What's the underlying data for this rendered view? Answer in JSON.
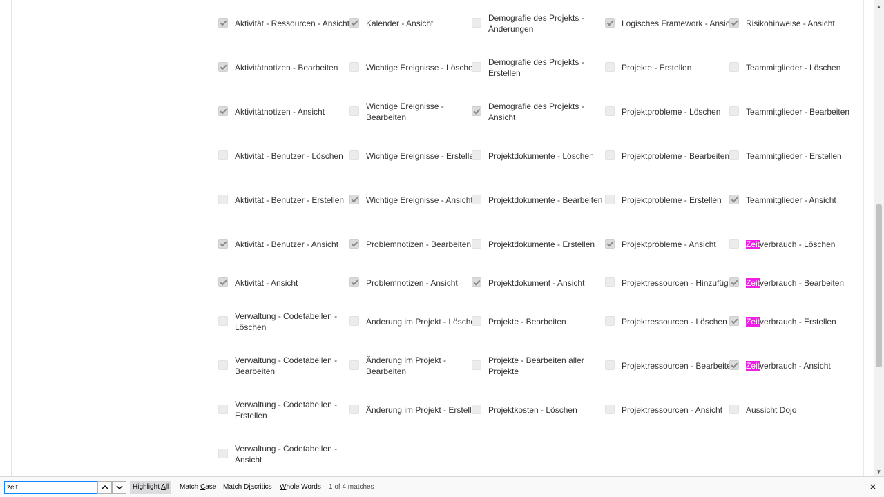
{
  "permissions": {
    "col1": [
      {
        "checked": true,
        "label": "Aktivität - Ressourcen - Ansicht"
      },
      {
        "checked": true,
        "label": "Aktivitätnotizen - Bearbeiten"
      },
      {
        "checked": true,
        "label": "Aktivitätnotizen - Ansicht"
      },
      {
        "checked": false,
        "label": "Aktivität - Benutzer - Löschen"
      },
      {
        "checked": false,
        "label": "Aktivität - Benutzer - Erstellen"
      },
      {
        "checked": true,
        "label": "Aktivität - Benutzer - Ansicht"
      },
      {
        "checked": true,
        "label": "Aktivität - Ansicht"
      },
      {
        "checked": false,
        "label": "Verwaltung - Codetabellen - Löschen"
      },
      {
        "checked": false,
        "label": "Verwaltung - Codetabellen - Bearbeiten"
      },
      {
        "checked": false,
        "label": "Verwaltung - Codetabellen - Erstellen"
      },
      {
        "checked": false,
        "label": "Verwaltung - Codetabellen - Ansicht"
      }
    ],
    "col2": [
      {
        "checked": true,
        "label": "Kalender - Ansicht"
      },
      {
        "checked": false,
        "label": "Wichtige Ereignisse - Löschen"
      },
      {
        "checked": false,
        "label": "Wichtige Ereignisse - Bearbeiten"
      },
      {
        "checked": false,
        "label": "Wichtige Ereignisse - Erstellen"
      },
      {
        "checked": true,
        "label": "Wichtige Ereignisse - Ansicht"
      },
      {
        "checked": true,
        "label": "Problemnotizen - Bearbeiten"
      },
      {
        "checked": true,
        "label": "Problemnotizen - Ansicht"
      },
      {
        "checked": false,
        "label": "Änderung im Projekt - Löschen"
      },
      {
        "checked": false,
        "label": "Änderung im Projekt - Bearbeiten"
      },
      {
        "checked": false,
        "label": "Änderung im Projekt - Erstellen"
      }
    ],
    "col3": [
      {
        "checked": false,
        "label": "Demografie des Projekts - Änderungen"
      },
      {
        "checked": false,
        "label": "Demografie des Projekts - Erstellen"
      },
      {
        "checked": true,
        "label": "Demografie des Projekts - Ansicht"
      },
      {
        "checked": false,
        "label": "Projektdokumente - Löschen"
      },
      {
        "checked": false,
        "label": "Projektdokumente - Bearbeiten"
      },
      {
        "checked": false,
        "label": "Projektdokumente - Erstellen"
      },
      {
        "checked": true,
        "label": "Projektdokument - Ansicht"
      },
      {
        "checked": false,
        "label": "Projekte - Bearbeiten"
      },
      {
        "checked": false,
        "label": "Projekte - Bearbeiten aller Projekte"
      },
      {
        "checked": false,
        "label": "Projektkosten - Löschen"
      }
    ],
    "col4": [
      {
        "checked": true,
        "label": "Logisches Framework - Ansicht"
      },
      {
        "checked": false,
        "label": "Projekte - Erstellen"
      },
      {
        "checked": false,
        "label": "Projektprobleme - Löschen"
      },
      {
        "checked": false,
        "label": "Projektprobleme - Bearbeiten"
      },
      {
        "checked": false,
        "label": "Projektprobleme - Erstellen"
      },
      {
        "checked": true,
        "label": "Projektprobleme - Ansicht"
      },
      {
        "checked": false,
        "label": "Projektressourcen - Hinzufügen"
      },
      {
        "checked": false,
        "label": "Projektressourcen - Löschen"
      },
      {
        "checked": false,
        "label": "Projektressourcen - Bearbeiten"
      },
      {
        "checked": false,
        "label": "Projektressourcen - Ansicht"
      }
    ],
    "col5": [
      {
        "checked": true,
        "label": "Risikohinweise - Ansicht"
      },
      {
        "checked": false,
        "label": "Teammitglieder - Löschen"
      },
      {
        "checked": false,
        "label": "Teammitglieder - Bearbeiten"
      },
      {
        "checked": false,
        "label": "Teammitglieder - Erstellen"
      },
      {
        "checked": true,
        "label": "Teammitglieder - Ansicht"
      },
      {
        "checked": false,
        "label": "Zeitverbrauch - Löschen",
        "highlight": "Zeit",
        "rest": "verbrauch - Löschen"
      },
      {
        "checked": true,
        "label": "Zeitverbrauch - Bearbeiten",
        "highlight": "Zeit",
        "rest": "verbrauch - Bearbeiten"
      },
      {
        "checked": true,
        "label": "Zeitverbrauch - Erstellen",
        "highlight": "Zeit",
        "rest": "verbrauch - Erstellen"
      },
      {
        "checked": true,
        "label": "Zeitverbrauch - Ansicht",
        "highlight": "Zeit",
        "rest": "verbrauch - Ansicht"
      },
      {
        "checked": false,
        "label": "Aussicht Dojo"
      }
    ]
  },
  "findbar": {
    "query": "zeit",
    "highlight_all": "Highlight All",
    "match_case": "Match Case",
    "match_diacritics": "Match Diacritics",
    "whole_words": "Whole Words",
    "status": "1 of 4 matches",
    "prev_icon": "chevron-up-icon",
    "next_icon": "chevron-down-icon",
    "close_icon": "close-icon",
    "highlight_color": "#ef1de5",
    "input_border_color": "#0a84ff"
  }
}
